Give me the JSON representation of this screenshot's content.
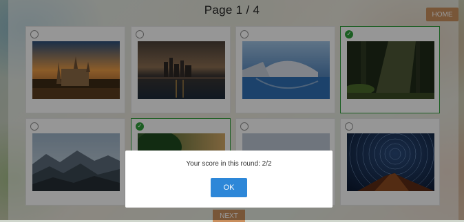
{
  "header": {
    "page_label": "Page 1 / 4",
    "home_label": "HOME"
  },
  "grid": {
    "cards": [
      {
        "name": "card-castle",
        "selected": false
      },
      {
        "name": "card-city-skyline",
        "selected": false
      },
      {
        "name": "card-futuristic-building",
        "selected": false
      },
      {
        "name": "card-forest-sunrays",
        "selected": true
      },
      {
        "name": "card-mountains",
        "selected": false
      },
      {
        "name": "card-trees-sunset",
        "selected": true
      },
      {
        "name": "card-hidden",
        "selected": false
      },
      {
        "name": "card-star-trails",
        "selected": false
      }
    ]
  },
  "footer": {
    "next_label": "NEXT"
  },
  "dialog": {
    "message": "Your score in this round: 2/2",
    "ok_label": "OK"
  },
  "colors": {
    "accent": "#2d87d8",
    "selected": "#2e9d3a",
    "nav_button": "#c98f5e"
  }
}
